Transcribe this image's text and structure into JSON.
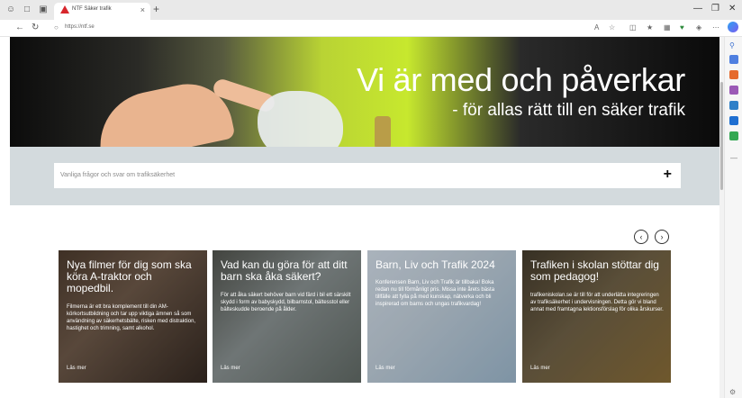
{
  "browser": {
    "tab_title": "NTF Säker trafik",
    "url": "https://ntf.se",
    "new_tab": "+",
    "tab_close": "×",
    "minimize": "—",
    "restore": "❐",
    "close": "✕",
    "icons": [
      "profile-icon",
      "workspaces-icon",
      "tab-actions-icon",
      "back-icon",
      "refresh-icon",
      "lock-icon",
      "read-aloud-icon",
      "favorite-icon",
      "split-screen-icon",
      "favorites-icon",
      "collections-icon",
      "performance-icon",
      "extensions-icon",
      "more-icon",
      "copilot-icon"
    ],
    "accent": "#d7262c"
  },
  "hero": {
    "title": "Vi är med och påverkar",
    "subtitle": "- för allas rätt till en säker trafik"
  },
  "faq": {
    "placeholder": "Vanliga frågor och svar om trafiksäkerhet",
    "expand_icon": "+"
  },
  "carousel": {
    "prev": "‹",
    "next": "›"
  },
  "cards": [
    {
      "title": "Nya filmer för dig som ska köra A-traktor och mopedbil.",
      "text": "Filmerna är ett bra komplement till din AM-körkortsutbildning och tar upp viktiga ämnen så som användning av säkerhetsbälte, risken med distraktion, hastighet och trimning, samt alkohol.",
      "link": "Läs mer"
    },
    {
      "title": "Vad kan du göra för att ditt barn ska åka säkert?",
      "text": "För att åka säkert behöver barn vid färd i bil ett särskilt skydd i form av babyskydd, bilbarnstol, bältesstol eller bälteskudde beroende på ålder.",
      "link": "Läs mer"
    },
    {
      "title": "Barn, Liv och Trafik 2024",
      "text": "Konferensen Barn, Liv och Trafik är tillbaka! Boka redan nu till förmånligt pris. Missa inte årets bästa tillfälle att fylla på med kunskap, nätverka och bli inspirerad om barns och ungas trafikvardag!",
      "link": "Läs mer"
    },
    {
      "title": "Trafiken i skolan stöttar dig som pedagog!",
      "text": "trafikeniskolan.se är till för att underlätta integreringen av trafiksäkerhet i undervisningen. Detta gör vi bland annat med framtagna lektionsförslag för olika årskurser.",
      "link": "Läs mer"
    }
  ]
}
